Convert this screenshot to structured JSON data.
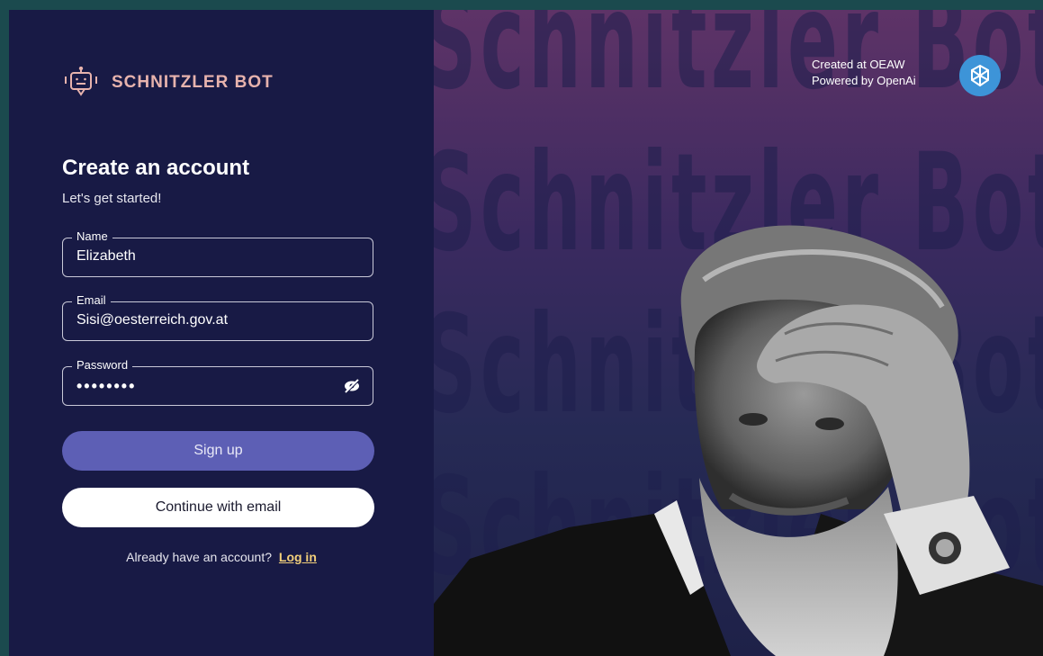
{
  "brand": {
    "name": "SCHNITZLER BOT",
    "color": "#e7b3ad"
  },
  "form": {
    "title": "Create an account",
    "subtitle": "Let's get started!",
    "name": {
      "label": "Name",
      "value": "Elizabeth"
    },
    "email": {
      "label": "Email",
      "value": "Sisi@oesterreich.gov.at"
    },
    "password": {
      "label": "Password",
      "masked_value": "••••••••"
    },
    "signup_label": "Sign up",
    "continue_email_label": "Continue with email",
    "login_prompt": "Already have an account?",
    "login_link": "Log in"
  },
  "credits": {
    "line1": "Created at OEAW",
    "line2": "Powered by OpenAi"
  },
  "background_text": [
    "Schnitzler Bot",
    "Schnitzler Bot",
    "Schnitzler Bot"
  ],
  "icons": {
    "logo": "robot-chat-icon",
    "password_toggle": "eye-off-icon",
    "openai": "openai-logo-icon"
  },
  "colors": {
    "panel_bg": "#181a45",
    "primary_button": "#5d5fb5",
    "link": "#f2cf7a",
    "openai_badge": "#3d94d8"
  }
}
